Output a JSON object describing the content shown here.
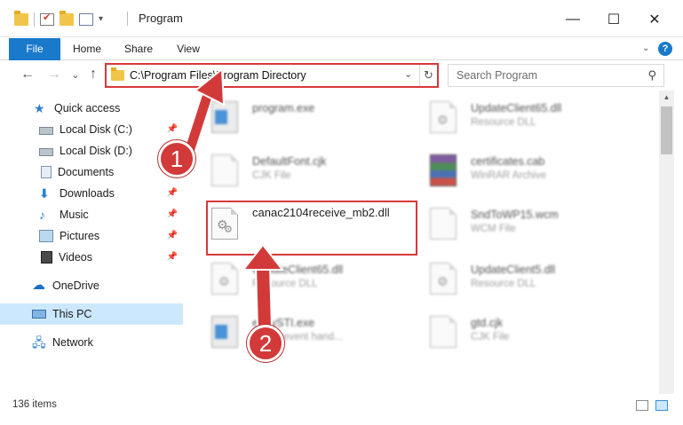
{
  "window": {
    "title": "Program",
    "minimize": "—",
    "maximize": "☐",
    "close": "✕"
  },
  "ribbon": {
    "tabs": [
      "File",
      "Home",
      "Share",
      "View"
    ],
    "help": "?",
    "collapse": "⌄"
  },
  "nav": {
    "back": "←",
    "forward": "→",
    "recent": "⌄",
    "up": "↑",
    "address": "C:\\Program Files\\Program Directory",
    "refresh": "↻",
    "dropdown": "⌄",
    "search_placeholder": "Search Program",
    "search_icon": "⚲"
  },
  "sidebar": {
    "items": [
      {
        "label": "Quick access",
        "icon": "star-icon",
        "pinned": false
      },
      {
        "label": "Local Disk (C:)",
        "icon": "disk-icon",
        "pinned": true
      },
      {
        "label": "Local Disk (D:)",
        "icon": "disk-icon",
        "pinned": false
      },
      {
        "label": "Documents",
        "icon": "documents-icon",
        "pinned": true
      },
      {
        "label": "Downloads",
        "icon": "downloads-icon",
        "pinned": true
      },
      {
        "label": "Music",
        "icon": "music-icon",
        "pinned": true
      },
      {
        "label": "Pictures",
        "icon": "pictures-icon",
        "pinned": true
      },
      {
        "label": "Videos",
        "icon": "videos-icon",
        "pinned": true
      },
      {
        "label": "OneDrive",
        "icon": "onedrive-icon",
        "pinned": false
      },
      {
        "label": "This PC",
        "icon": "pc-icon",
        "pinned": false,
        "selected": true
      },
      {
        "label": "Network",
        "icon": "network-icon",
        "pinned": false
      }
    ]
  },
  "files": [
    {
      "name": "program.exe",
      "type": "",
      "icon": "program-icon",
      "col": 0,
      "row": 0
    },
    {
      "name": "UpdateClient65.dll",
      "type": "Resource DLL",
      "icon": "dll-icon",
      "col": 1,
      "row": 0
    },
    {
      "name": "DefaultFont.cjk",
      "type": "CJK File",
      "icon": "file-icon",
      "col": 0,
      "row": 1
    },
    {
      "name": "certificates.cab",
      "type": "WinRAR Archive",
      "icon": "archive-icon",
      "col": 1,
      "row": 1
    },
    {
      "name": "canac2104receive_mb2.dll",
      "type": "",
      "icon": "dll-icon",
      "col": 0,
      "row": 2,
      "highlight": true
    },
    {
      "name": "SndToWP15.wcm",
      "type": "WCM File",
      "icon": "file-icon",
      "col": 1,
      "row": 2
    },
    {
      "name": "UpdateClient65.dll",
      "type": "Resource DLL",
      "icon": "dll-icon",
      "col": 0,
      "row": 3
    },
    {
      "name": "UpdateClient5.dll",
      "type": "Resource DLL",
      "icon": "dll-icon",
      "col": 1,
      "row": 3
    },
    {
      "name": "ebbySTI.exe",
      "type": "...ur in event hand...",
      "icon": "exe-icon",
      "col": 0,
      "row": 4
    },
    {
      "name": "gtd.cjk",
      "type": "CJK File",
      "icon": "file-icon",
      "col": 1,
      "row": 4
    }
  ],
  "annotations": {
    "step1": "1",
    "step2": "2",
    "color": "#d23a3a"
  },
  "status": {
    "items_count": "136 items"
  },
  "colors": {
    "accent": "#1979ca",
    "highlight_border": "#d7383b",
    "selected_bg": "#cce8ff"
  }
}
